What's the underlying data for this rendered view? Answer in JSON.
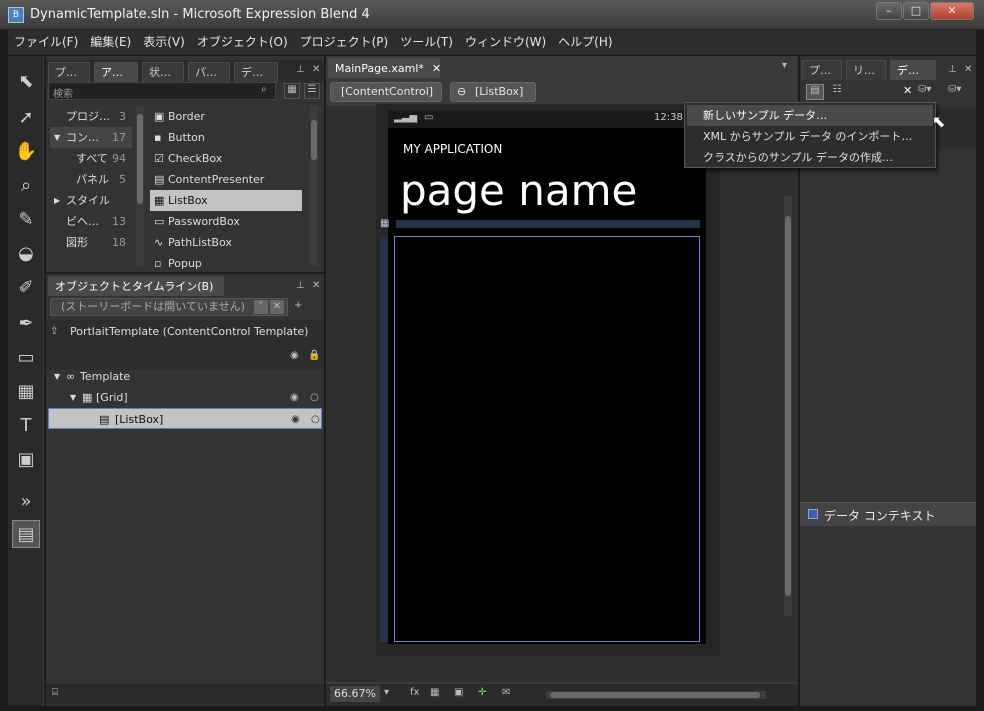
{
  "window": {
    "title": "DynamicTemplate.sln - Microsoft Expression Blend 4",
    "app_icon": "B",
    "min": "–",
    "max": "□",
    "close": "✕"
  },
  "menu": [
    "ファイル(F)",
    "編集(E)",
    "表示(V)",
    "オブジェクト(O)",
    "プロジェクト(P)",
    "ツール(T)",
    "ウィンドウ(W)",
    "ヘルプ(H)"
  ],
  "assets": {
    "tabs": [
      "プ…",
      "ア…",
      "状…",
      "パ…",
      "デ…"
    ],
    "search_placeholder": "検索",
    "categories": [
      {
        "label": "プロジ…",
        "count": "3"
      },
      {
        "label": "コン…",
        "count": "17"
      },
      {
        "label": "すべて",
        "count": "94"
      },
      {
        "label": "パネル",
        "count": "5"
      },
      {
        "label": "スタイル",
        "count": ""
      },
      {
        "label": "ビヘ…",
        "count": "13"
      },
      {
        "label": "図形",
        "count": "18"
      }
    ],
    "controls": [
      "Border",
      "Button",
      "CheckBox",
      "ContentPresenter",
      "ListBox",
      "PasswordBox",
      "PathListBox",
      "Popup"
    ]
  },
  "objects": {
    "title": "オブジェクトとタイムライン(B)",
    "storyboard": "(ストーリーボードは開いていません)",
    "scope": "PortlaitTemplate (ContentControl Template)",
    "tree": [
      "Template",
      "[Grid]",
      "[ListBox]"
    ]
  },
  "document": {
    "tab": "MainPage.xaml*",
    "breadcrumb": [
      "[ContentControl]",
      "[ListBox]"
    ],
    "app_title": "MY APPLICATION",
    "page_title": "page name",
    "time": "12:38",
    "zoom": "66.67%"
  },
  "right_panel": {
    "tabs": [
      "プ…",
      "リ…",
      "デ…"
    ],
    "popup_items": [
      "新しいサンプル データ…",
      "XML からサンプル データ のインポート…",
      "クラスからのサンプル データの作成…"
    ],
    "data_context": "データ コンテキスト"
  }
}
